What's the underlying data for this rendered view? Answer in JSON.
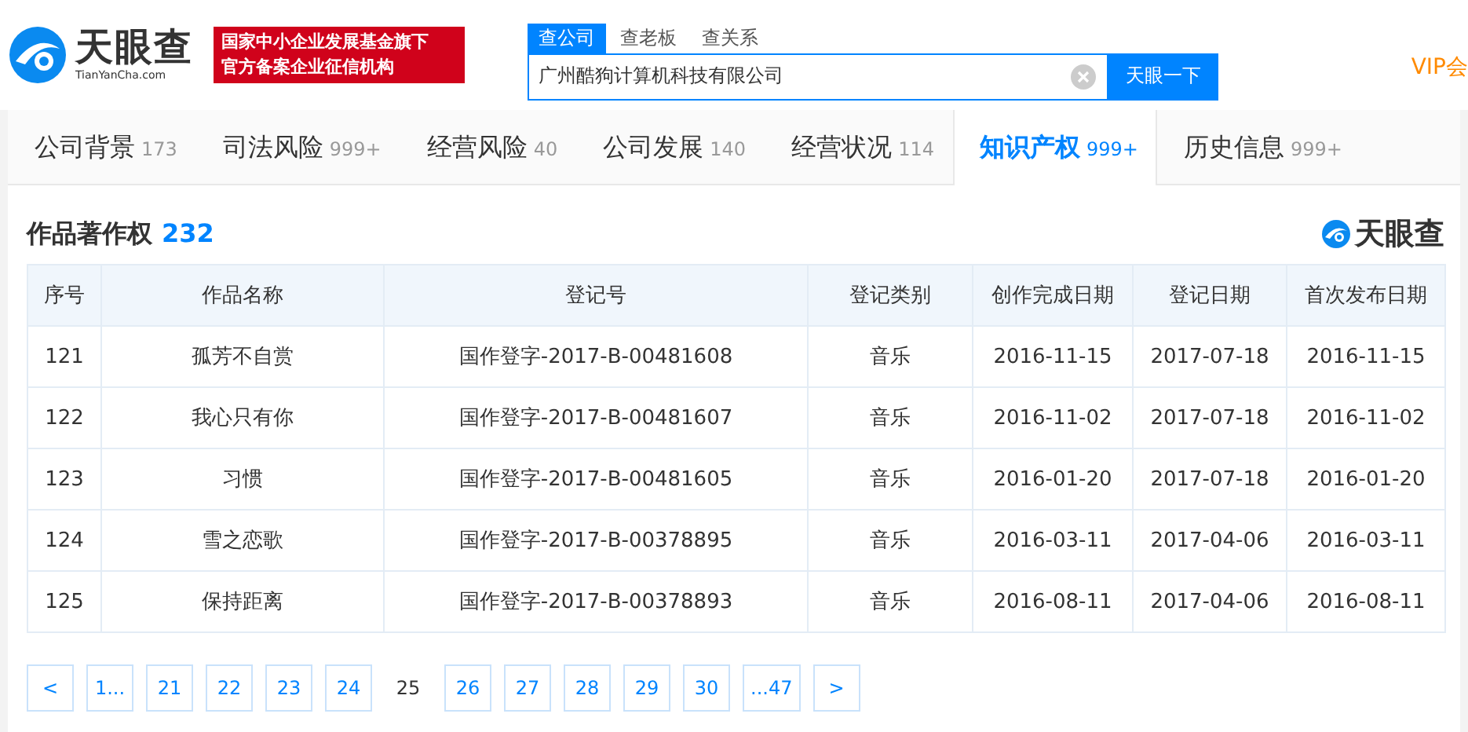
{
  "header": {
    "logo_text": "天眼查",
    "logo_domain": "TianYanCha.com",
    "badge_lines": [
      "国家中小企业发展基金旗下",
      "官方备案企业征信机构"
    ],
    "search_tabs": [
      {
        "label": "查公司",
        "selected": true
      },
      {
        "label": "查老板",
        "selected": false
      },
      {
        "label": "查关系",
        "selected": false
      }
    ],
    "search_value": "广州酷狗计算机科技有限公司",
    "search_button": "天眼一下",
    "vip": "VIP会"
  },
  "tabs": [
    {
      "label": "公司背景",
      "count": "173",
      "selected": false
    },
    {
      "label": "司法风险",
      "count": "999+",
      "selected": false
    },
    {
      "label": "经营风险",
      "count": "40",
      "selected": false
    },
    {
      "label": "公司发展",
      "count": "140",
      "selected": false
    },
    {
      "label": "经营状况",
      "count": "114",
      "selected": false
    },
    {
      "label": "知识产权",
      "count": "999+",
      "selected": true
    },
    {
      "label": "历史信息",
      "count": "999+",
      "selected": false
    }
  ],
  "section": {
    "title": "作品著作权",
    "count": "232",
    "brand": "天眼查"
  },
  "table": {
    "columns": [
      "序号",
      "作品名称",
      "登记号",
      "登记类别",
      "创作完成日期",
      "登记日期",
      "首次发布日期"
    ],
    "rows": [
      [
        "121",
        "孤芳不自赏",
        "国作登字-2017-B-00481608",
        "音乐",
        "2016-11-15",
        "2017-07-18",
        "2016-11-15"
      ],
      [
        "122",
        "我心只有你",
        "国作登字-2017-B-00481607",
        "音乐",
        "2016-11-02",
        "2017-07-18",
        "2016-11-02"
      ],
      [
        "123",
        "习惯",
        "国作登字-2017-B-00481605",
        "音乐",
        "2016-01-20",
        "2017-07-18",
        "2016-01-20"
      ],
      [
        "124",
        "雪之恋歌",
        "国作登字-2017-B-00378895",
        "音乐",
        "2016-03-11",
        "2017-04-06",
        "2016-03-11"
      ],
      [
        "125",
        "保持距离",
        "国作登字-2017-B-00378893",
        "音乐",
        "2016-08-11",
        "2017-04-06",
        "2016-08-11"
      ]
    ]
  },
  "pagination": [
    {
      "label": "<",
      "selected": false
    },
    {
      "label": "1...",
      "selected": false
    },
    {
      "label": "21",
      "selected": false
    },
    {
      "label": "22",
      "selected": false
    },
    {
      "label": "23",
      "selected": false
    },
    {
      "label": "24",
      "selected": false
    },
    {
      "label": "25",
      "selected": true
    },
    {
      "label": "26",
      "selected": false
    },
    {
      "label": "27",
      "selected": false
    },
    {
      "label": "28",
      "selected": false
    },
    {
      "label": "29",
      "selected": false
    },
    {
      "label": "30",
      "selected": false
    },
    {
      "label": "...47",
      "selected": false
    },
    {
      "label": ">",
      "selected": false
    }
  ]
}
